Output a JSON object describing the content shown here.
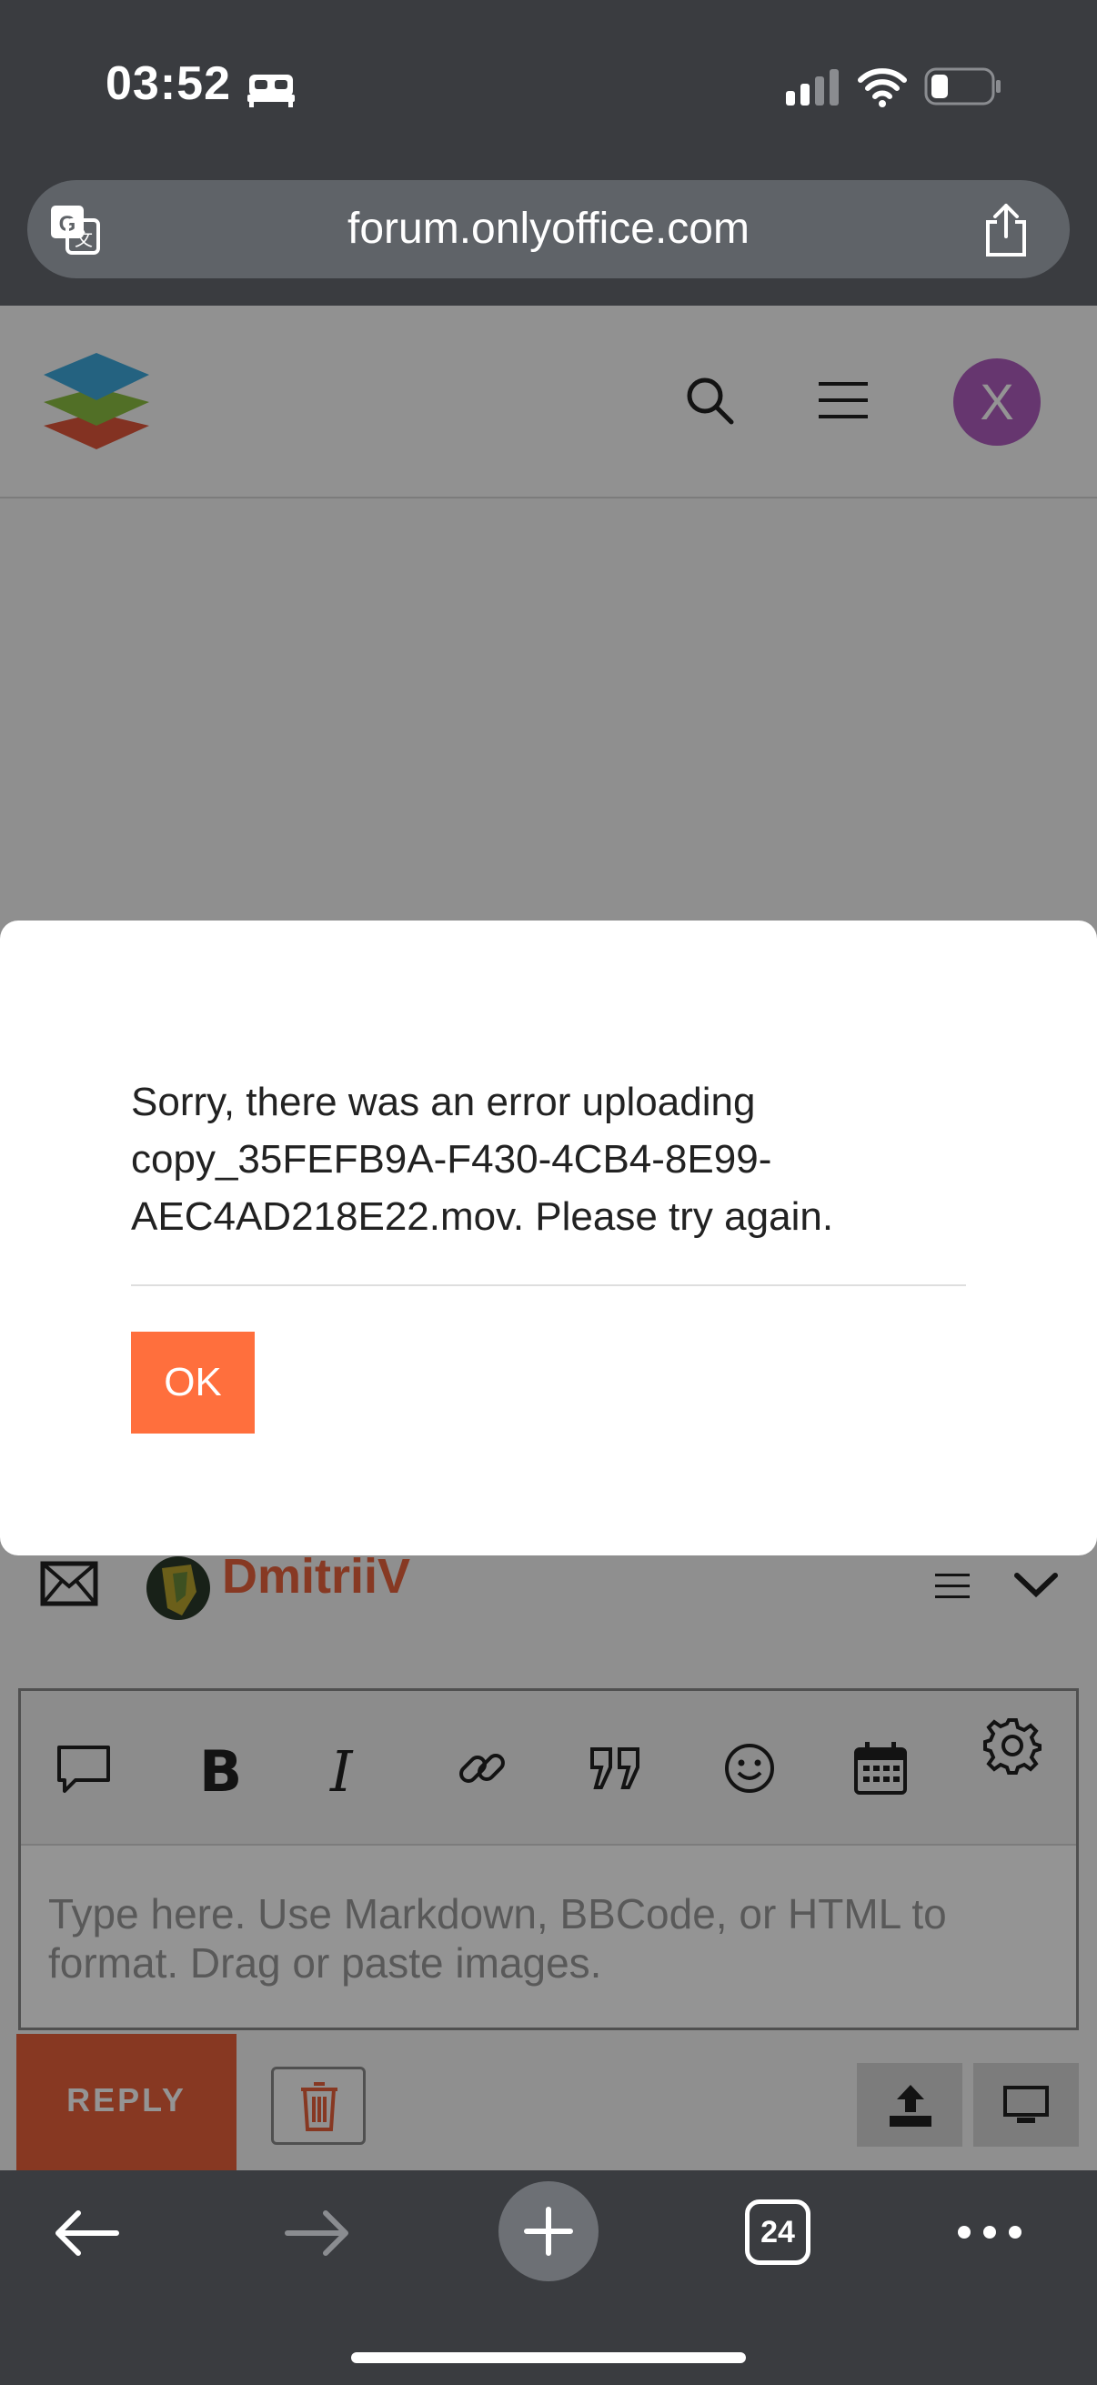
{
  "status_bar": {
    "time": "03:52",
    "sleep_icon": "bed-icon",
    "signal_icon": "signal-icon",
    "wifi_icon": "wifi-icon",
    "battery_icon": "battery-icon"
  },
  "browser": {
    "url": "forum.onlyoffice.com",
    "translate_icon": "translate-icon",
    "share_icon": "share-icon"
  },
  "site_header": {
    "logo_icon": "onlyoffice-logo-icon",
    "search_icon": "search-icon",
    "menu_icon": "hamburger-menu-icon",
    "avatar_letter": "X",
    "avatar_color": "#b05dc0"
  },
  "composer": {
    "username": "DmitriiV",
    "username_color": "#e8623d",
    "toolbar_icons": [
      "quote-bubble-icon",
      "bold-icon",
      "italic-icon",
      "link-icon",
      "blockquote-icon",
      "emoji-icon",
      "calendar-icon",
      "gear-icon"
    ],
    "placeholder": "Type here. Use Markdown, BBCode, or HTML to format. Drag or paste images.",
    "reply_label": "REPLY"
  },
  "modal": {
    "message": "Sorry, there was an error uploading copy_35FEFB9A-F430-4CB4-8E99-AEC4AD218E22.mov. Please try again.",
    "ok_label": "OK",
    "accent_color": "#ff6f3d"
  },
  "bottom_bar": {
    "tabs_count": "24"
  }
}
